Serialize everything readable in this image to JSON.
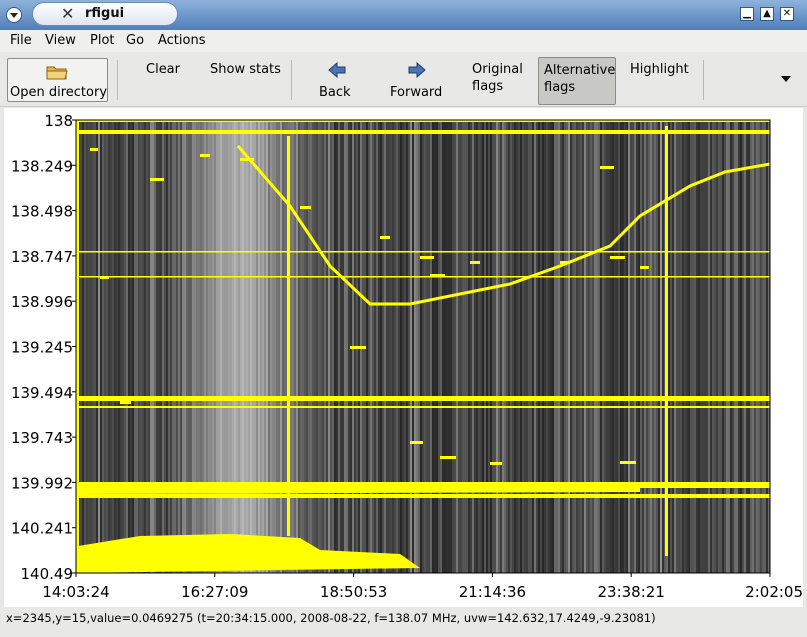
{
  "window": {
    "title": "rfigui"
  },
  "menubar": {
    "items": [
      "File",
      "View",
      "Plot",
      "Go",
      "Actions"
    ]
  },
  "toolbar": {
    "open_directory": "Open directory",
    "clear": "Clear",
    "show_stats": "Show stats",
    "back": "Back",
    "forward": "Forward",
    "original_flags_1": "Original",
    "original_flags_2": "flags",
    "alternative_flags_1": "Alternative",
    "alternative_flags_2": "flags",
    "highlight": "Highlight"
  },
  "plot": {
    "y_ticks": [
      "138",
      "138.249",
      "138.498",
      "138.747",
      "138.996",
      "139.245",
      "139.494",
      "139.743",
      "139.992",
      "140.241",
      "140.49"
    ],
    "x_ticks": [
      "14:03:24",
      "16:27:09",
      "18:50:53",
      "21:14:36",
      "23:38:21",
      "2:02:05"
    ],
    "colors": {
      "flag": "#ffff00",
      "background": "#1e1e1e"
    }
  },
  "status": {
    "text": "x=2345,y=15,value=0.0469275 (t=20:34:15.000, 2008-08-22, f=138.07 MHz, uvw=142.632,17.4249,-9.23081)"
  }
}
